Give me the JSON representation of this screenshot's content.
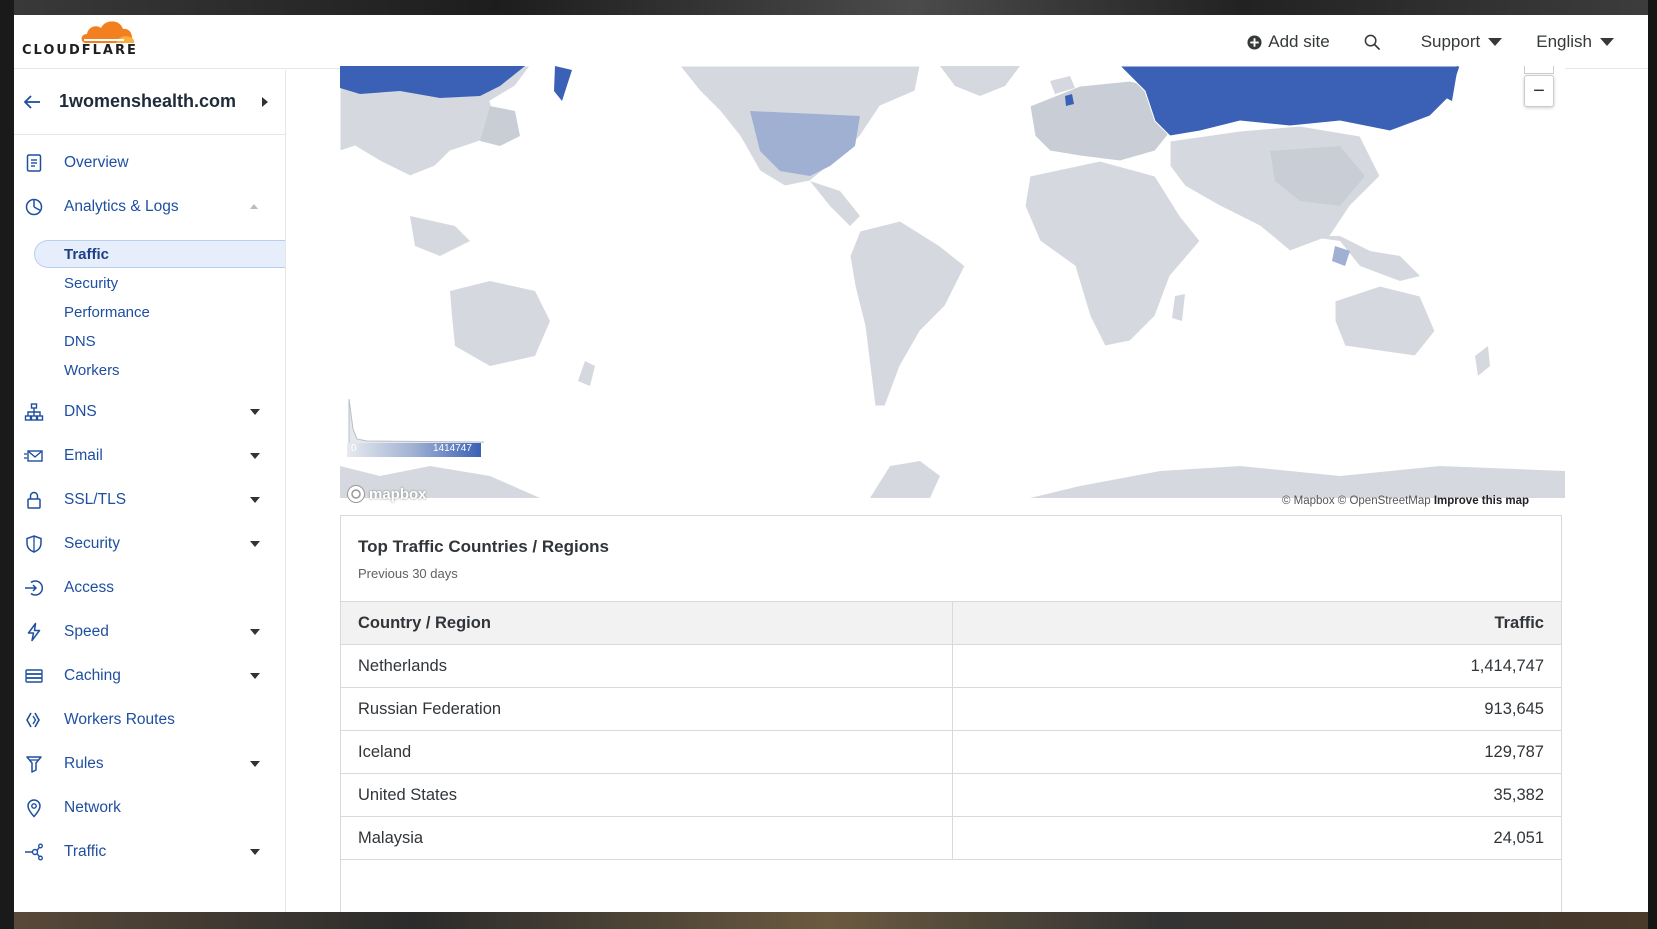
{
  "header": {
    "logo_text": "CLOUDFLARE",
    "add_site": "Add site",
    "support": "Support",
    "language": "English"
  },
  "sidebar": {
    "site_name": "1womenshealth.com",
    "items": [
      {
        "label": "Overview",
        "icon": "document-icon"
      },
      {
        "label": "Analytics & Logs",
        "icon": "pie-chart-icon"
      },
      {
        "label": "DNS",
        "icon": "network-tree-icon"
      },
      {
        "label": "Email",
        "icon": "envelope-icon"
      },
      {
        "label": "SSL/TLS",
        "icon": "lock-icon"
      },
      {
        "label": "Security",
        "icon": "shield-icon"
      },
      {
        "label": "Access",
        "icon": "access-icon"
      },
      {
        "label": "Speed",
        "icon": "lightning-icon"
      },
      {
        "label": "Caching",
        "icon": "server-stack-icon"
      },
      {
        "label": "Workers Routes",
        "icon": "workers-icon"
      },
      {
        "label": "Rules",
        "icon": "rules-icon"
      },
      {
        "label": "Network",
        "icon": "location-pin-icon"
      },
      {
        "label": "Traffic",
        "icon": "traffic-icon"
      }
    ],
    "analytics_sub": [
      {
        "label": "Traffic",
        "active": true
      },
      {
        "label": "Security",
        "active": false
      },
      {
        "label": "Performance",
        "active": false
      },
      {
        "label": "DNS",
        "active": false
      },
      {
        "label": "Workers",
        "active": false
      }
    ]
  },
  "map": {
    "legend_min": "0",
    "legend_max": "1414747",
    "mapbox_logo": "mapbox",
    "attribution_mapbox": "© Mapbox",
    "attribution_osm": "© OpenStreetMap",
    "improve": "Improve this map",
    "zoom_out": "−",
    "colors": {
      "high": "#3b61b6",
      "mid": "#9fb0d3",
      "low": "#d5d9df"
    }
  },
  "traffic_table": {
    "title": "Top Traffic Countries / Regions",
    "subtitle": "Previous 30 days",
    "col_country": "Country / Region",
    "col_traffic": "Traffic",
    "rows": [
      {
        "country": "Netherlands",
        "traffic": "1,414,747"
      },
      {
        "country": "Russian Federation",
        "traffic": "913,645"
      },
      {
        "country": "Iceland",
        "traffic": "129,787"
      },
      {
        "country": "United States",
        "traffic": "35,382"
      },
      {
        "country": "Malaysia",
        "traffic": "24,051"
      }
    ]
  },
  "colors": {
    "accent": "#1f4fa0",
    "brand_orange": "#f38020"
  }
}
